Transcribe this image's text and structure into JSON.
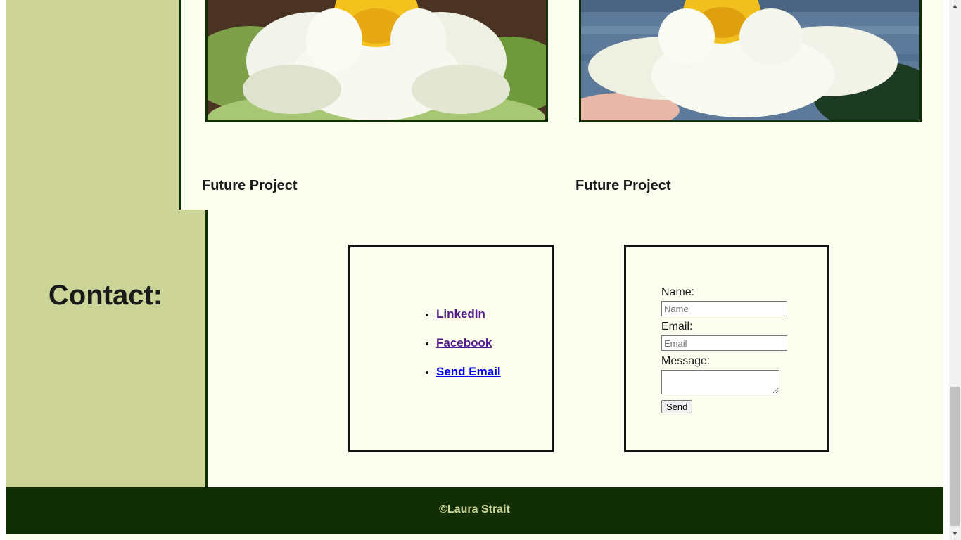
{
  "projects": [
    {
      "title": "Future Project",
      "image": "white-water-lily-photo"
    },
    {
      "title": "Future Project",
      "image": "white-water-lily-on-water-photo"
    }
  ],
  "contact": {
    "heading": "Contact:",
    "links": [
      {
        "label": "LinkedIn",
        "state": "visited"
      },
      {
        "label": "Facebook",
        "state": "visited"
      },
      {
        "label": "Send Email",
        "state": "unvisited"
      }
    ],
    "form": {
      "name_label": "Name:",
      "name_placeholder": "Name",
      "email_label": "Email:",
      "email_placeholder": "Email",
      "message_label": "Message:",
      "send_label": "Send"
    }
  },
  "footer": {
    "copyright": "©Laura Strait"
  },
  "colors": {
    "sidebar": "#ccd597",
    "background": "#fbfdef",
    "dark_green": "#112e05",
    "visited_link": "#551a8b",
    "link": "#0000ee"
  },
  "scrollbar": {
    "position_fraction": 0.95
  }
}
